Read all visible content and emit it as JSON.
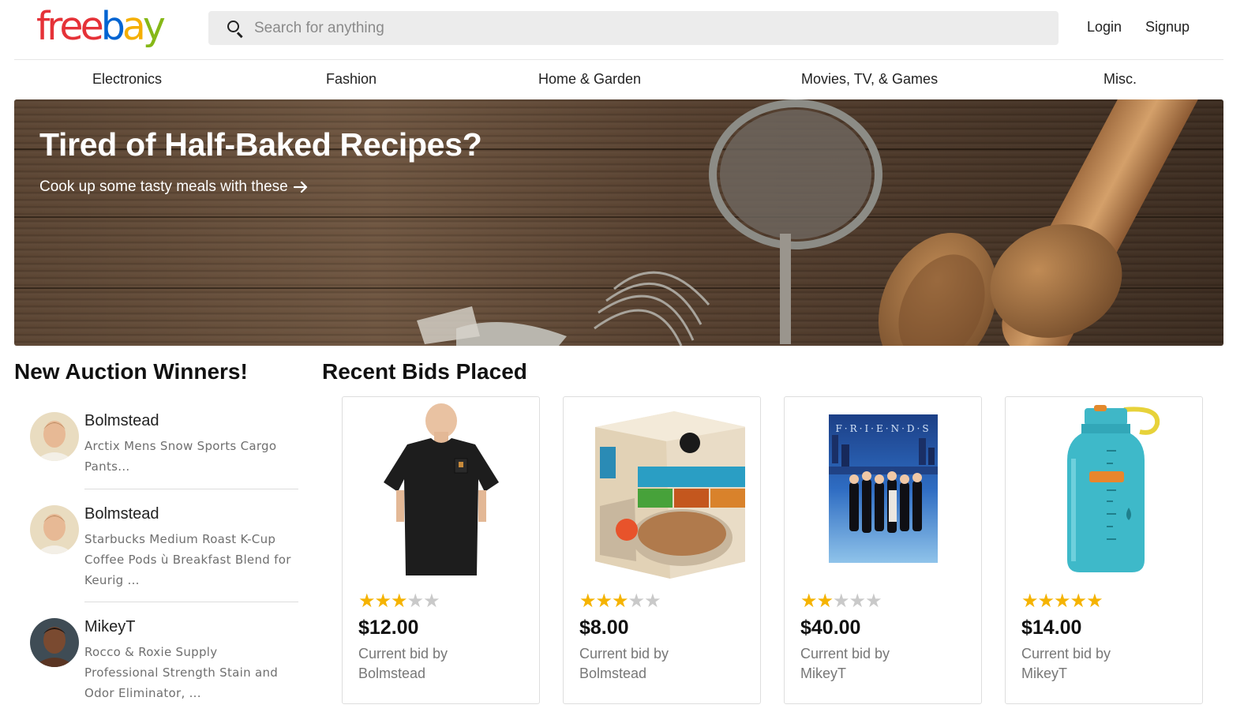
{
  "brand": {
    "logo_letters": [
      "f",
      "r",
      "e",
      "e",
      "b",
      "a",
      "y"
    ],
    "logo_colors": [
      "#e53238",
      "#e53238",
      "#e53238",
      "#e53238",
      "#0064d2",
      "#f5af02",
      "#86b817"
    ]
  },
  "search": {
    "placeholder": "Search for anything"
  },
  "auth": {
    "login": "Login",
    "signup": "Signup"
  },
  "nav": [
    "Electronics",
    "Fashion",
    "Home & Garden",
    "Movies, TV, & Games",
    "Misc."
  ],
  "hero": {
    "title": "Tired of Half-Baked Recipes?",
    "subtitle": "Cook up some tasty meals with these"
  },
  "winners_section": {
    "title": "New Auction Winners!",
    "items": [
      {
        "name": "Bolmstead",
        "description": "Arctix Mens Snow Sports Cargo Pants..."
      },
      {
        "name": "Bolmstead",
        "description": "Starbucks Medium Roast K-Cup Coffee Pods ù Breakfast Blend for Keurig ..."
      },
      {
        "name": "MikeyT",
        "description": "Rocco & Roxie Supply Professional Strength Stain and Odor Eliminator, ..."
      }
    ]
  },
  "bids_section": {
    "title": "Recent Bids Placed",
    "cards": [
      {
        "product": "black t-shirt",
        "rating": 3,
        "price": "$12.00",
        "bid_label": "Current bid by",
        "bidder": "Bolmstead"
      },
      {
        "product": "oatmeal box",
        "rating": 3,
        "price": "$8.00",
        "bid_label": "Current bid by",
        "bidder": "Bolmstead"
      },
      {
        "product": "friends dvd",
        "rating": 2,
        "price": "$40.00",
        "bid_label": "Current bid by",
        "bidder": "MikeyT"
      },
      {
        "product": "water bottle",
        "rating": 5,
        "price": "$14.00",
        "bid_label": "Current bid by",
        "bidder": "MikeyT"
      }
    ]
  },
  "colors": {
    "star_on": "#f5b301",
    "star_off": "#c9c9c9",
    "search_bg": "#ececec"
  }
}
